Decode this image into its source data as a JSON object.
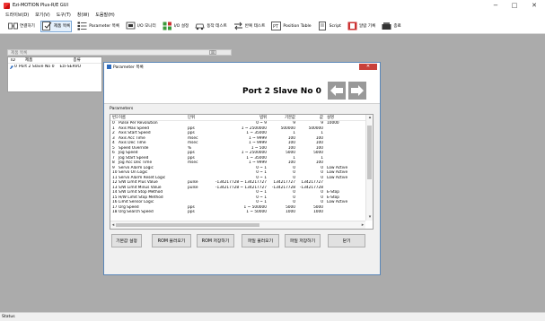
{
  "window": {
    "title": "Ezi-MOTION Plus-R/E GUI",
    "minimize_glyph": "−",
    "maximize_glyph": "□",
    "close_glyph": "✕"
  },
  "menu": [
    "드라이브(D)",
    "보기(V)",
    "도구(T)",
    "창(W)",
    "도움말(H)"
  ],
  "toolbar": [
    {
      "label": "연결하기",
      "icon": "connect-icon"
    },
    {
      "label": "제품 목록",
      "icon": "product-list-icon"
    },
    {
      "label": "Parameter 목록",
      "icon": "parameter-list-icon"
    },
    {
      "label": "I/O 모니터",
      "icon": "io-monitor-icon"
    },
    {
      "label": "I/O 설정",
      "icon": "io-settings-icon"
    },
    {
      "label": "동작 테스트",
      "icon": "motion-test-icon"
    },
    {
      "label": "반복 테스트",
      "icon": "repeat-test-icon"
    },
    {
      "label": "Position Table",
      "icon": "position-table-icon"
    },
    {
      "label": "Script",
      "icon": "script-icon"
    },
    {
      "label": "알람 기록",
      "icon": "alarm-log-icon"
    },
    {
      "label": "종료",
      "icon": "exit-icon"
    }
  ],
  "product_list": {
    "title": "제품 목록",
    "close_glyph": "⊠",
    "columns": [
      "ID",
      "제품",
      "종류"
    ],
    "rows": [
      {
        "id": "0",
        "product": "Port 2 Slave No 0",
        "type": "Ezi-SERVO"
      }
    ]
  },
  "parameter_window": {
    "title": "Parameter 목록",
    "close_glyph": "✕",
    "device": "Port 2 Slave No 0",
    "section_label": "Parameters",
    "columns": [
      "번호",
      "이름",
      "단위",
      "범위",
      "기본값",
      "값",
      "설명"
    ],
    "rows": [
      {
        "no": "0",
        "name": "Pulse Per Revolution",
        "unit": "",
        "range": "0 ~ 9",
        "default": "9",
        "value": "9",
        "desc": "10000"
      },
      {
        "no": "1",
        "name": "Axis Max Speed",
        "unit": "pps",
        "range": "1 ~ 2500000",
        "default": "500000",
        "value": "500000",
        "desc": ""
      },
      {
        "no": "2",
        "name": "Axis Start Speed",
        "unit": "pps",
        "range": "1 ~ 35000",
        "default": "1",
        "value": "1",
        "desc": ""
      },
      {
        "no": "3",
        "name": "Axis Acc Time",
        "unit": "msec",
        "range": "1 ~ 9999",
        "default": "100",
        "value": "100",
        "desc": ""
      },
      {
        "no": "4",
        "name": "Axis Dec Time",
        "unit": "msec",
        "range": "1 ~ 9999",
        "default": "100",
        "value": "100",
        "desc": ""
      },
      {
        "no": "5",
        "name": "Speed Override",
        "unit": "%",
        "range": "1 ~ 500",
        "default": "100",
        "value": "100",
        "desc": ""
      },
      {
        "no": "6",
        "name": "Jog Speed",
        "unit": "pps",
        "range": "1 ~ 2500000",
        "default": "5000",
        "value": "5000",
        "desc": ""
      },
      {
        "no": "7",
        "name": "Jog Start Speed",
        "unit": "pps",
        "range": "1 ~ 35000",
        "default": "1",
        "value": "1",
        "desc": ""
      },
      {
        "no": "8",
        "name": "Jog Acc Dec Time",
        "unit": "msec",
        "range": "1 ~ 9999",
        "default": "100",
        "value": "100",
        "desc": ""
      },
      {
        "no": "9",
        "name": "Servo Alarm Logic",
        "unit": "",
        "range": "0 ~ 1",
        "default": "0",
        "value": "0",
        "desc": "Low Active"
      },
      {
        "no": "10",
        "name": "Servo On Logic",
        "unit": "",
        "range": "0 ~ 1",
        "default": "0",
        "value": "0",
        "desc": "Low Active"
      },
      {
        "no": "11",
        "name": "Servo Alarm Reset Logic",
        "unit": "",
        "range": "0 ~ 1",
        "default": "0",
        "value": "0",
        "desc": "Low Active"
      },
      {
        "no": "12",
        "name": "S/W Limit Plus Value",
        "unit": "pulse",
        "range": "-134217728 ~ 134217727",
        "default": "134217727",
        "value": "134217727",
        "desc": ""
      },
      {
        "no": "13",
        "name": "S/W Limit Minus Value",
        "unit": "pulse",
        "range": "-134217728 ~ 134217727",
        "default": "-134217728",
        "value": "-134217728",
        "desc": ""
      },
      {
        "no": "14",
        "name": "S/W Limit Stop Method",
        "unit": "",
        "range": "0 ~ 1",
        "default": "0",
        "value": "0",
        "desc": "E-Stop"
      },
      {
        "no": "15",
        "name": "H/W Limit Stop Method",
        "unit": "",
        "range": "0 ~ 1",
        "default": "0",
        "value": "0",
        "desc": "E-Stop"
      },
      {
        "no": "16",
        "name": "Limit Sensor Logic",
        "unit": "",
        "range": "0 ~ 1",
        "default": "0",
        "value": "0",
        "desc": "Low Active"
      },
      {
        "no": "17",
        "name": "Org Speed",
        "unit": "pps",
        "range": "1 ~ 500000",
        "default": "5000",
        "value": "5000",
        "desc": ""
      },
      {
        "no": "18",
        "name": "Org Search Speed",
        "unit": "pps",
        "range": "1 ~ 50000",
        "default": "1000",
        "value": "1000",
        "desc": ""
      }
    ],
    "buttons": [
      "기본값 설정",
      "ROM 불러오기",
      "ROM 저장하기",
      "파일 불러오기",
      "파일 저장하기",
      "닫기"
    ]
  },
  "statusbar": {
    "text": "Status"
  },
  "colors": {
    "workspace": "#ababab",
    "nav_button": "#999999",
    "close_button": "#c9403a"
  }
}
